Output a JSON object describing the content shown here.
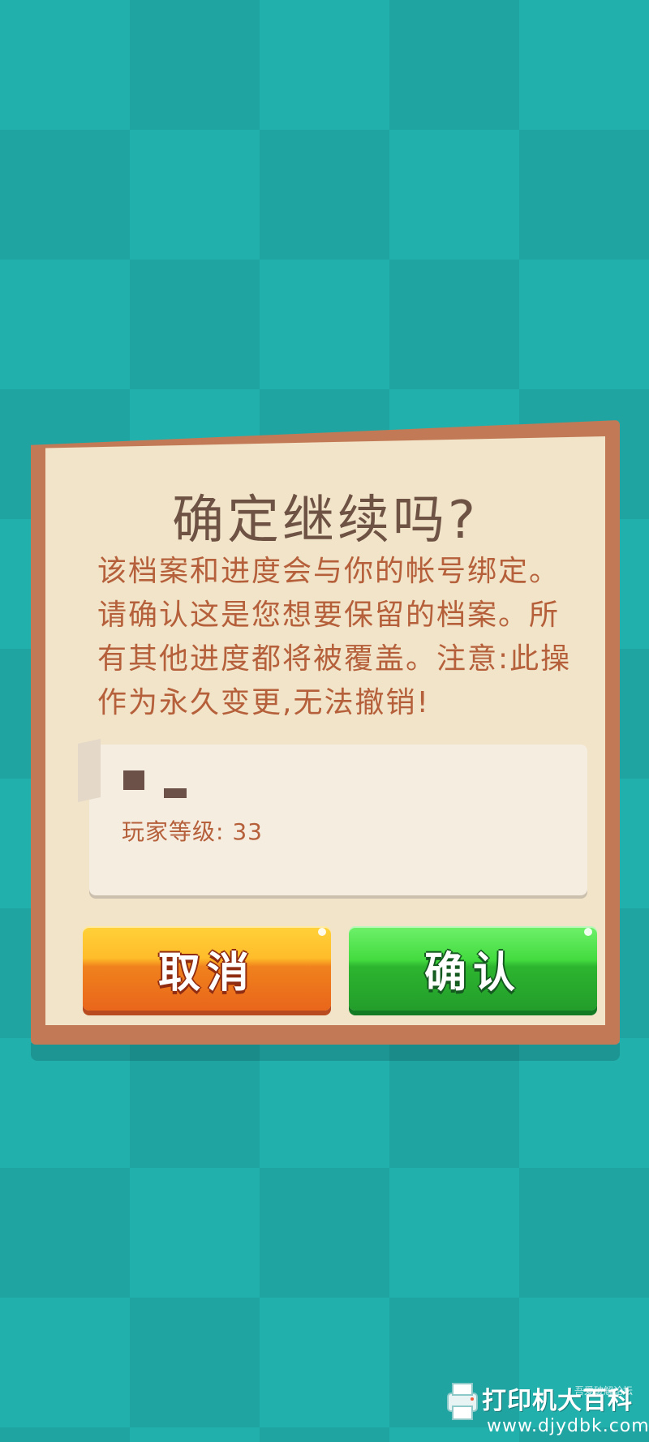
{
  "dialog": {
    "title": "确定继续吗?",
    "message": "该档案和进度会与你的帐号绑定。请确认这是您想要保留的档案。所有其他进度都将被覆盖。注意:此操作为永久变更,无法撤销!",
    "save_card": {
      "player_level_label": "玩家等级:",
      "player_level_value": "33"
    },
    "cancel_label": "取消",
    "confirm_label": "确认"
  },
  "watermark": {
    "text": "打印机大百科",
    "small_text": "吾爱破解论坛",
    "url": "www.djydbk.com"
  },
  "colors": {
    "background": "#22b0ad",
    "dialog_border": "#c27a56",
    "dialog_panel": "#f1e4c9",
    "title_text": "#6e5344",
    "message_text": "#b5603a",
    "cancel_button": "#f0811d",
    "confirm_button": "#2db52f"
  }
}
